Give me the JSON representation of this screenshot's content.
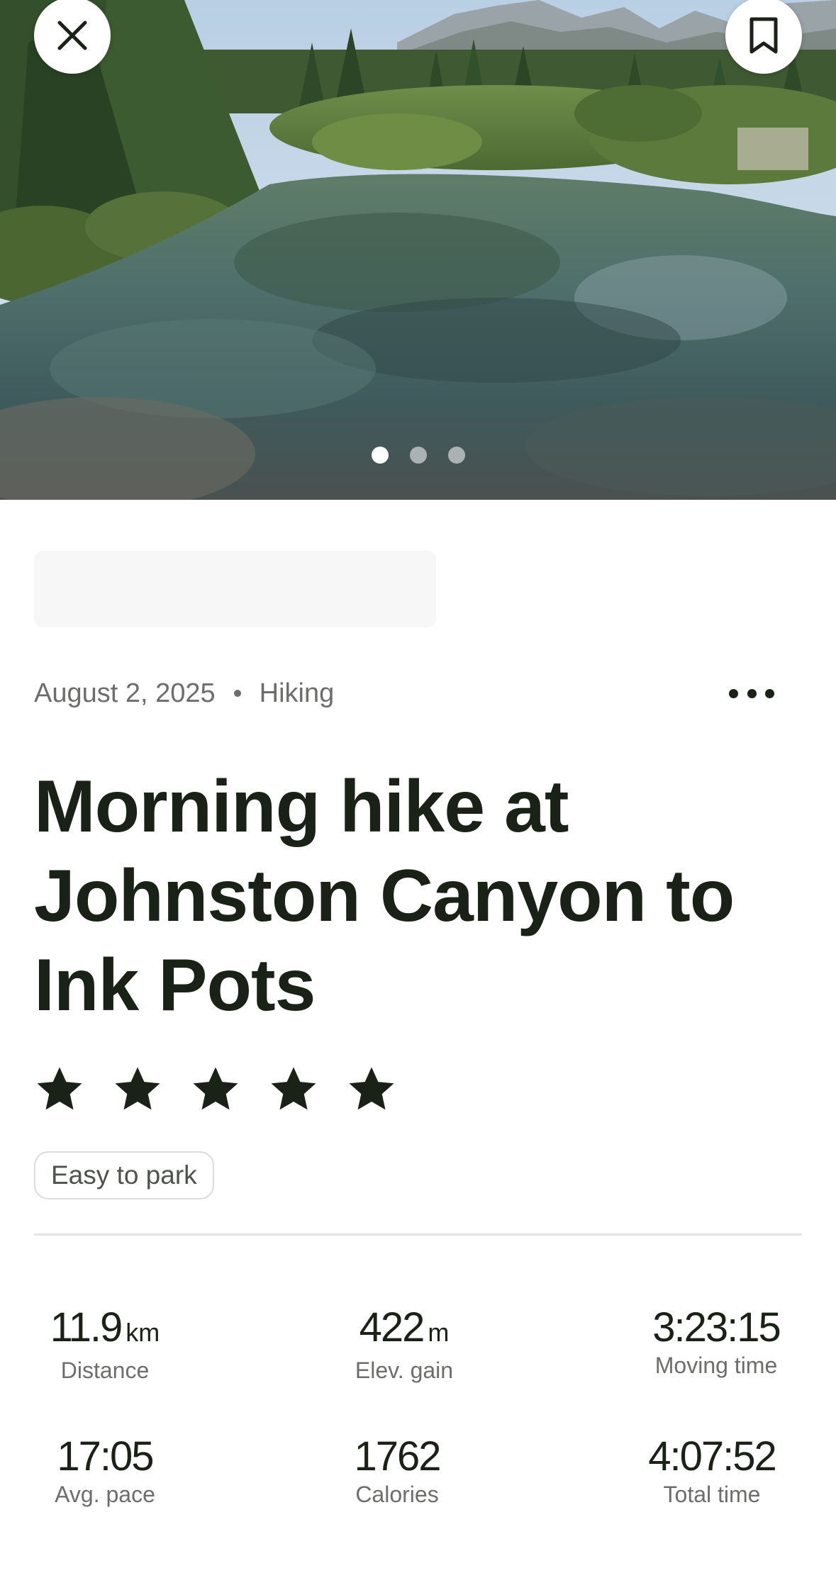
{
  "hero": {
    "carousel": {
      "count": 3,
      "active_index": 0
    },
    "close_icon": "close-icon",
    "bookmark_icon": "bookmark-icon"
  },
  "activity": {
    "date": "August 2, 2025",
    "type": "Hiking",
    "more_icon": "more-horizontal-icon",
    "title": "Morning hike at Johnston Canyon to Ink Pots",
    "rating": 5,
    "rating_max": 5,
    "tag": "Easy to park"
  },
  "stats": {
    "distance": {
      "value": "11.9",
      "unit": "km",
      "label": "Distance"
    },
    "elev_gain": {
      "value": "422",
      "unit": "m",
      "label": "Elev. gain"
    },
    "moving_time": {
      "value": "3:23:15",
      "label": "Moving time"
    },
    "avg_pace": {
      "value": "17:05",
      "label": "Avg. pace"
    },
    "calories": {
      "value": "1762",
      "label": "Calories"
    },
    "total_time": {
      "value": "4:07:52",
      "label": "Total time"
    }
  },
  "colors": {
    "text_primary": "#1a2218",
    "text_secondary": "#6b6e6a",
    "divider": "#e4e4e4"
  }
}
